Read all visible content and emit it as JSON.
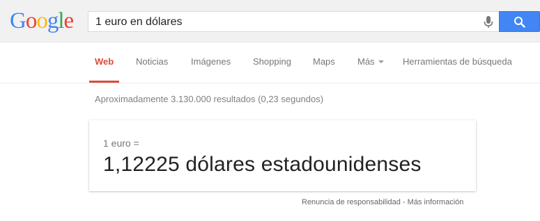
{
  "logo": {
    "letters": [
      "G",
      "o",
      "o",
      "g",
      "l",
      "e"
    ],
    "colors": [
      "#4285f4",
      "#ea4335",
      "#fbbc05",
      "#4285f4",
      "#34a853",
      "#ea4335"
    ]
  },
  "search": {
    "query": "1 euro en dólares",
    "mic_icon": "microphone-icon",
    "button_icon": "magnifier-icon",
    "button_color": "#4285f4"
  },
  "tabs": {
    "items": [
      {
        "label": "Web",
        "active": true
      },
      {
        "label": "Noticias"
      },
      {
        "label": "Imágenes"
      },
      {
        "label": "Shopping"
      },
      {
        "label": "Maps"
      },
      {
        "label": "Más",
        "dropdown": true
      },
      {
        "label": "Herramientas de búsqueda"
      }
    ],
    "accent": "#dd4b39"
  },
  "results": {
    "stats": "Aproximadamente 3.130.000 resultados (0,23 segundos)"
  },
  "converter": {
    "from_line": "1 euro =",
    "result_line": "1,12225 dólares estadounidenses"
  },
  "footer": {
    "disclaimer": "Renuncia de responsabilidad",
    "separator": " - ",
    "more_info": "Más información"
  }
}
